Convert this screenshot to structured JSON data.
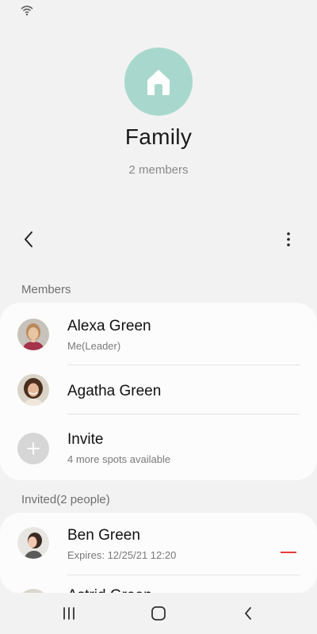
{
  "group": {
    "name": "Family",
    "member_count": "2 members",
    "icon": "home-icon",
    "icon_color": "#a8d8cd"
  },
  "members_section": {
    "header": "Members",
    "items": [
      {
        "name": "Alexa Green",
        "subtitle": "Me(Leader)"
      },
      {
        "name": "Agatha Green"
      }
    ],
    "invite": {
      "label": "Invite",
      "subtitle": "4 more spots available"
    }
  },
  "invited_section": {
    "header": "Invited(2 people)",
    "items": [
      {
        "name": "Ben Green",
        "subtitle": "Expires:  12/25/21 12:20"
      },
      {
        "name": "Astrid Green"
      }
    ]
  },
  "colors": {
    "remove_accent": "#e83a3a",
    "background": "#f2f2f2",
    "card": "#fcfcfc"
  }
}
